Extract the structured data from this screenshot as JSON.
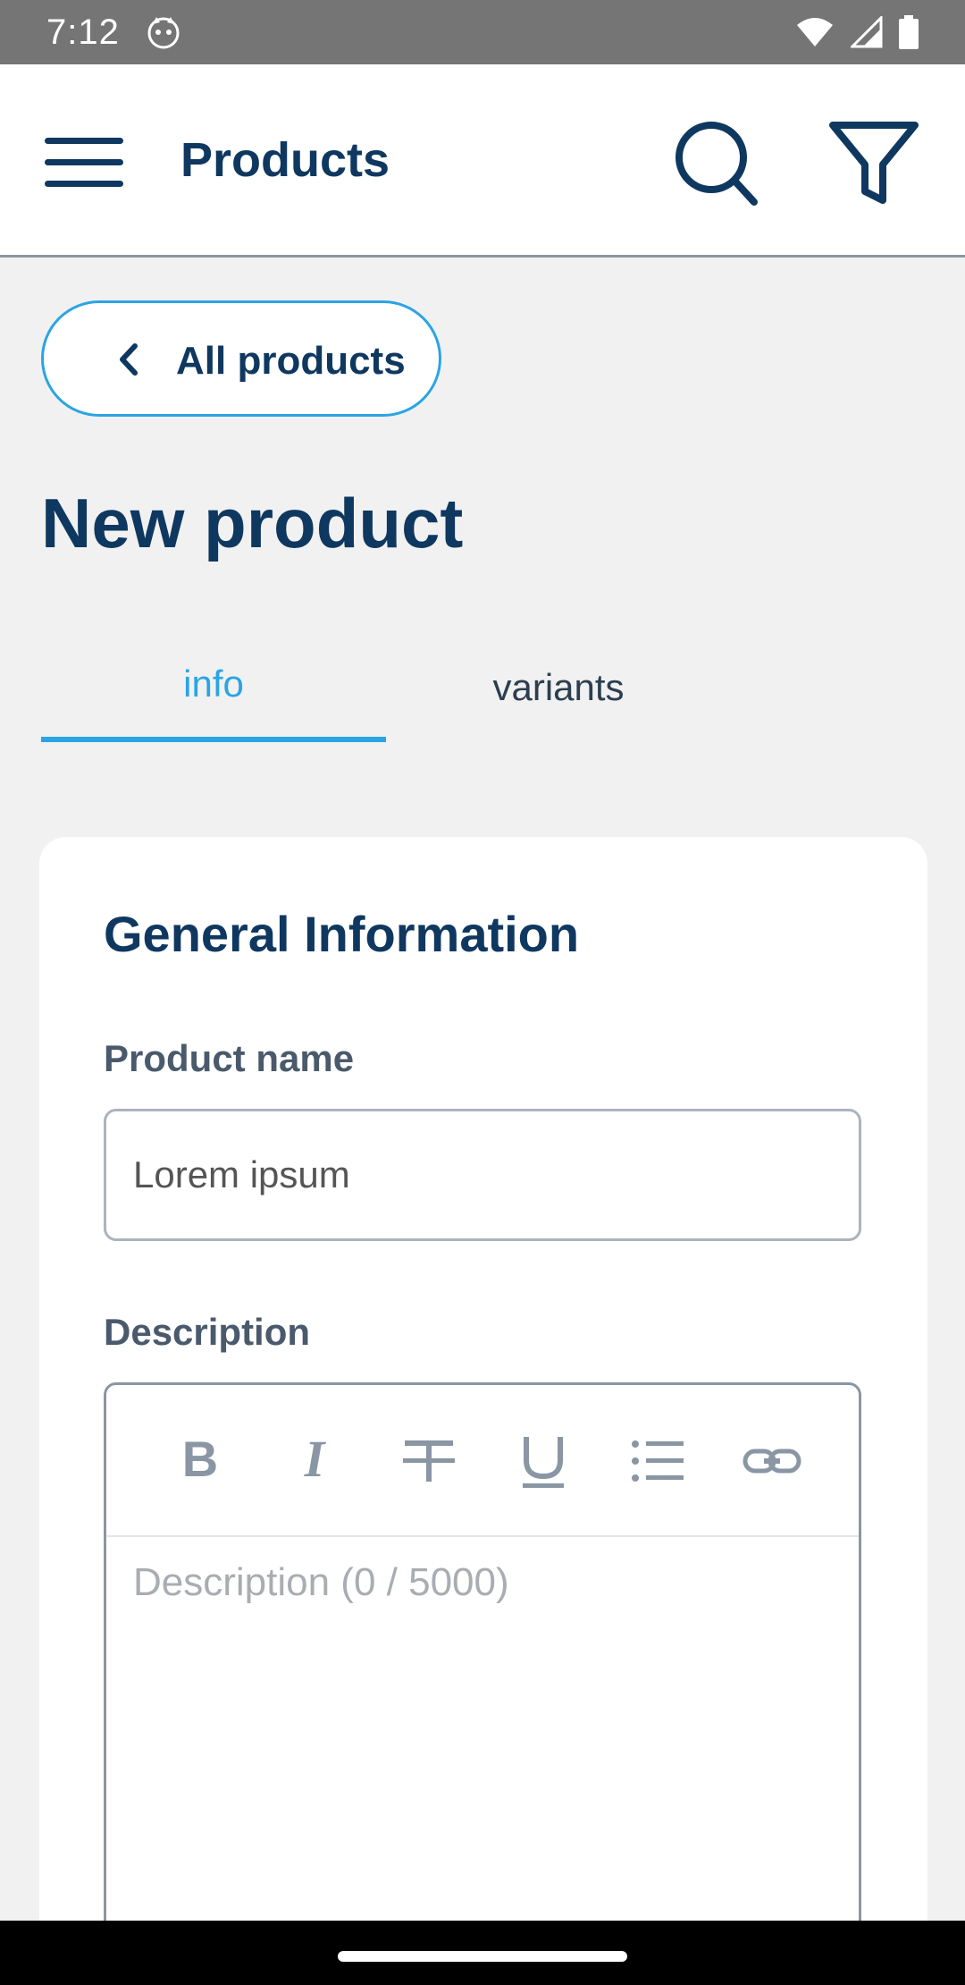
{
  "status_bar": {
    "time": "7:12"
  },
  "app_bar": {
    "title": "Products",
    "icons": [
      "menu-icon",
      "search-icon",
      "filter-icon"
    ]
  },
  "back_button": {
    "label": "All products"
  },
  "page": {
    "title": "New product"
  },
  "tabs": [
    {
      "label": "info",
      "active": true
    },
    {
      "label": "variants",
      "active": false
    }
  ],
  "card": {
    "title": "General Information",
    "product_name": {
      "label": "Product name",
      "value": "Lorem ipsum"
    },
    "description": {
      "label": "Description",
      "placeholder": "Description (0 / 5000)",
      "toolbar": [
        "bold-icon",
        "italic-icon",
        "strikethrough-icon",
        "underline-icon",
        "bulleted-list-icon",
        "link-icon"
      ]
    }
  },
  "colors": {
    "primary": "#0f3860",
    "accent": "#2aa4e4",
    "background": "#f1f1f1",
    "status_bar": "#757575"
  }
}
